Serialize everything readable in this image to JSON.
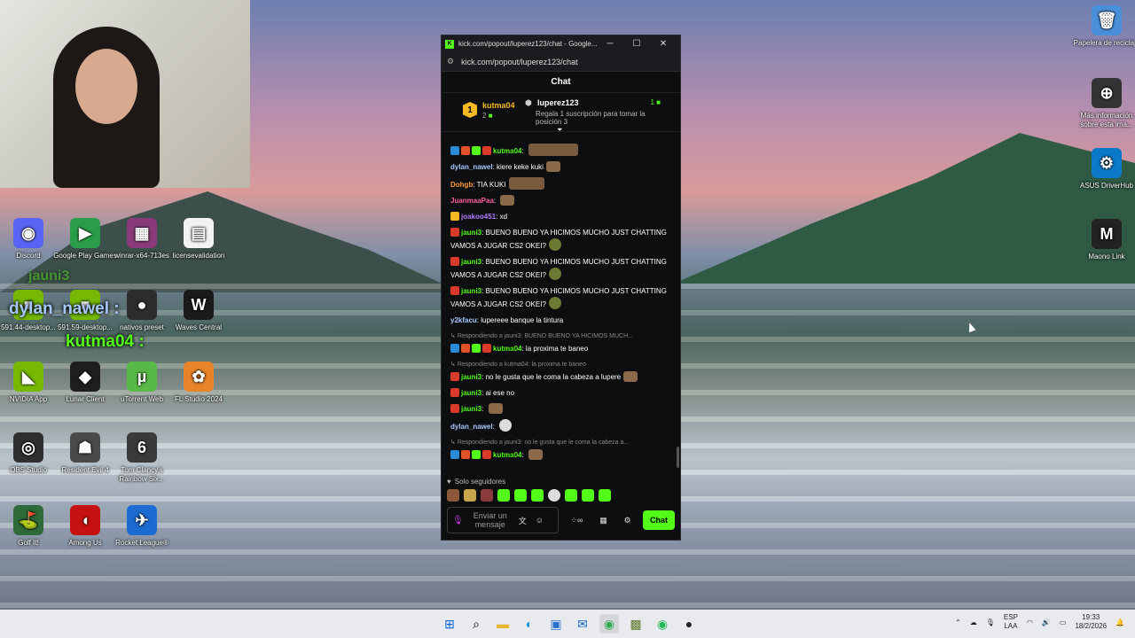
{
  "webcam": {},
  "desktop_icons": [
    {
      "label": "Discord",
      "glyph": "◉",
      "color": "#5865f2"
    },
    {
      "label": "Google Play Games",
      "glyph": "▶",
      "color": "#2a9d4a"
    },
    {
      "label": "winrar-x64-713es",
      "glyph": "▦",
      "color": "#8a3a7a"
    },
    {
      "label": "licensevalidation",
      "glyph": "▤",
      "color": "#f2f2f2"
    },
    {
      "label": "591.44-desktop...",
      "glyph": "■",
      "color": "#76b900"
    },
    {
      "label": "591.59-desktop...",
      "glyph": "■",
      "color": "#76b900"
    },
    {
      "label": "nativos preset",
      "glyph": "●",
      "color": "#2c2c2c"
    },
    {
      "label": "Waves Central",
      "glyph": "W",
      "color": "#1a1a1a"
    },
    {
      "label": "NVIDIA App",
      "glyph": "◣",
      "color": "#76b900"
    },
    {
      "label": "Lunar Client",
      "glyph": "◆",
      "color": "#1e1e1e"
    },
    {
      "label": "uTorrent Web",
      "glyph": "µ",
      "color": "#58b947"
    },
    {
      "label": "FL Studio 2024",
      "glyph": "✿",
      "color": "#e8842a"
    },
    {
      "label": "OBS Studio",
      "glyph": "◎",
      "color": "#302e31"
    },
    {
      "label": "Resident Evil 4",
      "glyph": "☗",
      "color": "#4a4a4a"
    },
    {
      "label": "Tom Clancy's Rainbow Six...",
      "glyph": "6",
      "color": "#3a3a3a"
    },
    {
      "label": "Golf It!",
      "glyph": "⛳",
      "color": "#2f6a3a"
    },
    {
      "label": "Among Us",
      "glyph": "◖",
      "color": "#c51111"
    },
    {
      "label": "Rocket League®",
      "glyph": "✈",
      "color": "#1b6bd1"
    },
    {
      "label": "Papelera de reciclaje",
      "glyph": "🗑",
      "color": "#4a90d9"
    },
    {
      "label": "Más información sobre esta ima...",
      "glyph": "⊕",
      "color": "#333"
    },
    {
      "label": "ASUS DriverHub",
      "glyph": "⚙",
      "color": "#0a7ac8"
    },
    {
      "label": "Maono Link",
      "glyph": "M",
      "color": "#222"
    }
  ],
  "overlay": {
    "line1": "jauni3",
    "line2_name": "dylan_nawel",
    "line2_sep": ":",
    "line3_name": "kutma04",
    "line3_sep": ":"
  },
  "browser": {
    "title": "kick.com/popout/luperez123/chat - Google...",
    "url": "kick.com/popout/luperez123/chat",
    "controls": {
      "min": "─",
      "max": "☐",
      "close": "✕"
    }
  },
  "chat": {
    "header": "Chat",
    "top_gifter": {
      "rank": "1",
      "user": "kutma04",
      "count": "2",
      "streamer": "luperez123",
      "desc": "Regala 1 suscripción para tomar la posición 3",
      "right_count": "1"
    },
    "messages": [
      {
        "user": "kutma04",
        "color": "#53fc18",
        "text": "",
        "badges": [
          "#2a8bd8",
          "#e0532a",
          "#53fc18",
          "#d93b2a"
        ],
        "emote": "big"
      },
      {
        "user": "dylan_nawel",
        "color": "#a7c8ff",
        "text": "kiere keke kuki",
        "emote": "normal"
      },
      {
        "user": "Dohgb",
        "color": "#ff9a3c",
        "text": "TIA KUKI",
        "emote": "big-short"
      },
      {
        "user": "JuanmaaPaa",
        "color": "#ff5fa2",
        "text": "",
        "emote": "normal"
      },
      {
        "user": "joakoo451",
        "color": "#b07aff",
        "text": "xd",
        "badges": [
          "#f6b924"
        ]
      },
      {
        "user": "jauni3",
        "color": "#53fc18",
        "text": "BUENO BUENO YA HICIMOS MUCHO JUST CHATTING VAMOS A JUGAR CS2 OKEI?",
        "badges": [
          "#d93b2a"
        ],
        "emote": "green"
      },
      {
        "user": "jauni3",
        "color": "#53fc18",
        "text": "BUENO BUENO YA HICIMOS MUCHO JUST CHATTING VAMOS A JUGAR CS2 OKEI?",
        "badges": [
          "#d93b2a"
        ],
        "emote": "green"
      },
      {
        "user": "jauni3",
        "color": "#53fc18",
        "text": "BUENO BUENO YA HICIMOS MUCHO JUST CHATTING VAMOS A JUGAR CS2 OKEI?",
        "badges": [
          "#d93b2a"
        ],
        "emote": "green"
      },
      {
        "user": "y2kfacu",
        "color": "#a7c8ff",
        "text": "lupereee banque la tintura"
      },
      {
        "reply": "Respondiendo a jauni3: BUENO BUENO YA HICIMOS MUCH...",
        "user": "kutma04",
        "color": "#53fc18",
        "text": "la proxima te baneo",
        "badges": [
          "#2a8bd8",
          "#e0532a",
          "#53fc18",
          "#d93b2a"
        ]
      },
      {
        "reply": "Respondiendo a kutma04: la proxima te baneo",
        "user": "jauni3",
        "color": "#53fc18",
        "text": "no le gusta que le coma la cabeza a lupere",
        "badges": [
          "#d93b2a"
        ],
        "emote": "normal"
      },
      {
        "user": "jauni3",
        "color": "#53fc18",
        "text": "ai ese no",
        "badges": [
          "#d93b2a"
        ]
      },
      {
        "user": "jauni3",
        "color": "#53fc18",
        "text": "",
        "badges": [
          "#d93b2a"
        ],
        "emote": "normal"
      },
      {
        "user": "dylan_nawel",
        "color": "#a7c8ff",
        "text": "",
        "emote": "white"
      },
      {
        "reply": "Respondiendo a jauni3: no le gusta que le coma la cabeza a...",
        "user": "kutma04",
        "color": "#53fc18",
        "text": "",
        "badges": [
          "#2a8bd8",
          "#e0532a",
          "#53fc18",
          "#d93b2a"
        ],
        "emote": "normal"
      }
    ],
    "followers_only": "Solo seguidores",
    "input_placeholder": "Enviar un mensaje",
    "send_label": "Chat"
  },
  "taskbar": {
    "lang_top": "ESP",
    "lang_bottom": "LAA",
    "time": "19:33",
    "date": "18/2/2026"
  }
}
